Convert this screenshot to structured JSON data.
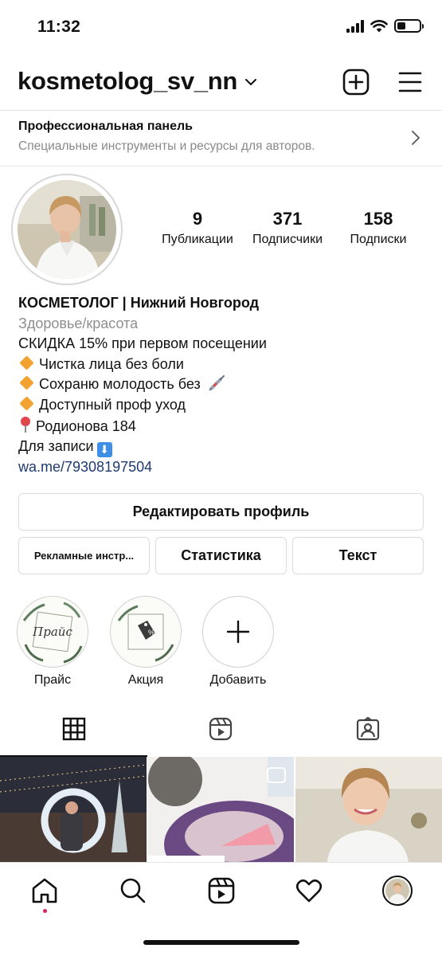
{
  "status_bar": {
    "time": "11:32"
  },
  "header": {
    "username": "kosmetolog_sv_nn"
  },
  "pro_panel": {
    "title": "Профессиональная панель",
    "subtitle": "Специальные инструменты и ресурсы для авторов."
  },
  "stats": {
    "posts": {
      "count": "9",
      "label": "Публикации"
    },
    "followers": {
      "count": "371",
      "label": "Подписчики"
    },
    "following": {
      "count": "158",
      "label": "Подписки"
    }
  },
  "bio": {
    "name": "КОСМЕТОЛОГ | Нижний Новгород",
    "category": "Здоровье/красота",
    "lines": [
      "СКИДКА 15% при первом посещении",
      "Чистка лица без боли",
      "Сохраню молодость без",
      "Доступный проф уход",
      "Родионова 184",
      "Для записи"
    ],
    "link": "wa.me/79308197504"
  },
  "buttons": {
    "edit_profile": "Редактировать профиль",
    "ad_tools": "Рекламные инстр...",
    "statistics": "Статистика",
    "text": "Текст"
  },
  "highlights": [
    {
      "label": "Прайс",
      "cover_text": "Прайс"
    },
    {
      "label": "Акция"
    },
    {
      "label": "Добавить"
    }
  ],
  "icons": {
    "header": [
      "chevron-down-icon",
      "new-post-icon",
      "menu-icon"
    ],
    "tabs": [
      "grid-icon",
      "reels-icon",
      "tagged-icon"
    ],
    "nav": [
      "home-icon",
      "search-icon",
      "reels-icon",
      "heart-icon",
      "profile-avatar"
    ]
  },
  "colors": {
    "link": "#1e3a6e",
    "diamond": "#f2a230",
    "secondary_text": "#8e8e8e",
    "notification_dot": "#e0245e"
  }
}
